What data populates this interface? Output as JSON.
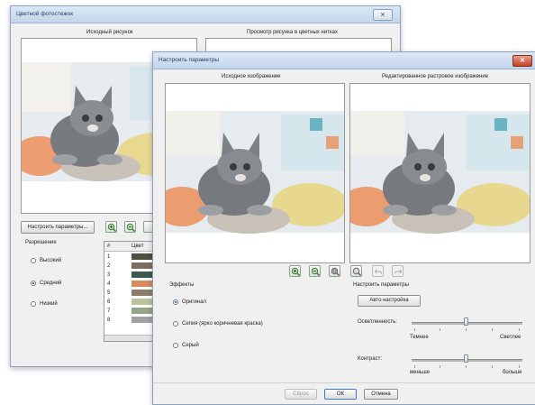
{
  "main_window": {
    "title": "Цветной фотостежок",
    "close_label": "⨯",
    "preview_left_header": "Исходный рисунок",
    "preview_right_header": "Просмотр рисунка в цветных нитках",
    "settings_button": "Настроить параметры...",
    "resolution_label": "Разрешение",
    "resolution_options": [
      "Высокий",
      "Средний",
      "Низкий"
    ],
    "resolution_selected": 1,
    "thread_table": {
      "headers": [
        "#",
        "Цвет"
      ],
      "rows": [
        "1",
        "2",
        "3",
        "4",
        "5",
        "6",
        "7",
        "8"
      ]
    }
  },
  "dialog": {
    "title": "Настроить параметры",
    "close_label": "✕",
    "original_header": "Исходное изображение",
    "edited_header": "Редактированное растровое изображение",
    "toolbar": [
      "zoom-in-icon",
      "zoom-out-icon",
      "zoom-fit-icon",
      "zoom-actual-icon",
      "undo-icon",
      "redo-icon"
    ],
    "effects_label": "Эффекты",
    "effects": [
      "Оригинал",
      "Сепия (ярко коричневая краска)",
      "Серый"
    ],
    "effects_selected": 0,
    "adjust_label": "Настроить параметры",
    "auto_button": "Авто настройка",
    "brightness_label": "Осветленность:",
    "brightness_left": "Темнее",
    "brightness_right": "Светлее",
    "brightness_value": 0.5,
    "contrast_label": "Контраст:",
    "contrast_left": "меньше",
    "contrast_right": "больше",
    "contrast_value": 0.5,
    "reset_button": "Сброс",
    "ok_button": "ОК",
    "cancel_button": "Отмена"
  },
  "colors": {
    "accent": "#1b4fa0",
    "title_gradient_top": "#dbe8f6",
    "thread_colors": [
      "#4e5042",
      "#7c6e5e",
      "#3c5a50",
      "#d98a5e",
      "#8c7d6a",
      "#b9c49a",
      "#93a585",
      "#a2a2a2"
    ]
  }
}
